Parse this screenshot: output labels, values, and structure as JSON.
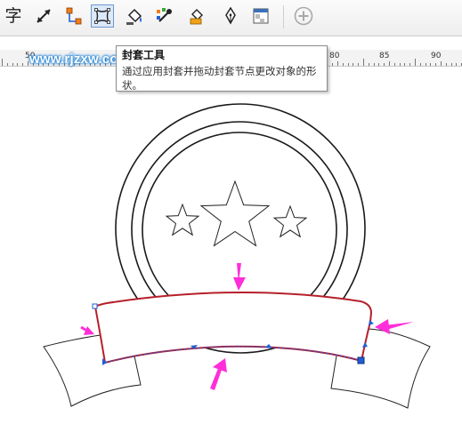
{
  "toolbar": {
    "tools": [
      {
        "name": "text-tool",
        "glyph": "字"
      },
      {
        "name": "dimension-tool"
      },
      {
        "name": "connector-tool"
      },
      {
        "name": "envelope-tool",
        "active": true
      },
      {
        "name": "fill-tool"
      },
      {
        "name": "eyedropper-tool"
      },
      {
        "name": "interactive-fill-tool"
      },
      {
        "name": "pen-outline-tool"
      },
      {
        "name": "transparency-tool"
      },
      {
        "name": "add-tool"
      }
    ]
  },
  "ruler": {
    "labels": [
      "50",
      "80",
      "85",
      "90"
    ]
  },
  "watermark": "www.rjzxw.com",
  "tooltip": {
    "title": "封套工具",
    "description": "通过应用封套并拖动封套节点更改对象的形状。"
  },
  "colors": {
    "envelope_outline": "#b5202a",
    "arrow": "#ff2ed9",
    "node": "#1f5fd6",
    "watermark_glow": "#1a7fd4"
  }
}
